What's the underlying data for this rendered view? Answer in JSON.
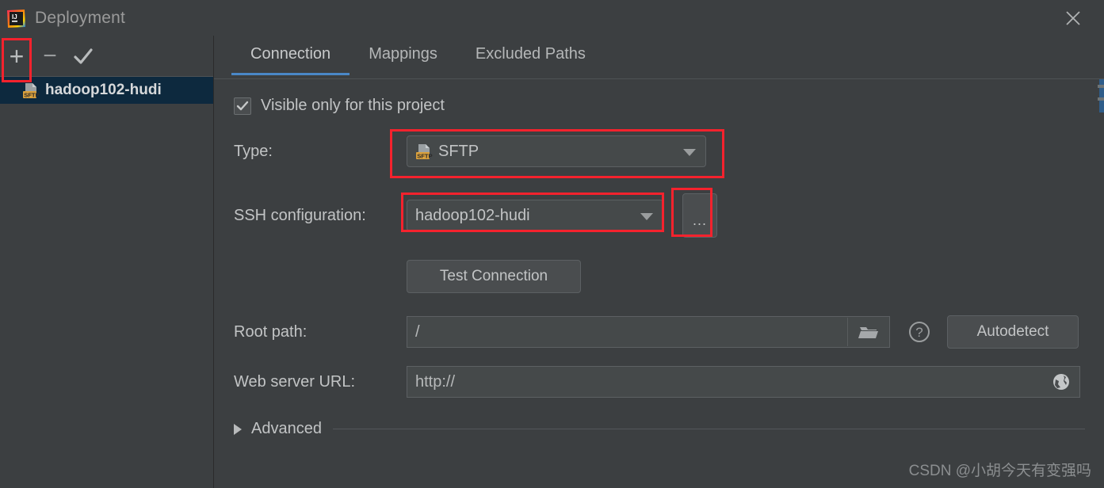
{
  "window": {
    "title": "Deployment",
    "logo_text": "IJ",
    "close_label": "×"
  },
  "left_panel": {
    "toolbar": [
      {
        "name": "add-button",
        "glyph": "+"
      },
      {
        "name": "remove-button",
        "glyph": "−"
      },
      {
        "name": "apply-button",
        "glyph": "✓"
      }
    ],
    "items": [
      {
        "label": "hadoop102-hudi",
        "type": "SFTP",
        "selected": true
      }
    ]
  },
  "tabs": [
    {
      "label": "Connection",
      "active": true
    },
    {
      "label": "Mappings",
      "active": false
    },
    {
      "label": "Excluded Paths",
      "active": false
    }
  ],
  "connection": {
    "visible_only_checkbox": {
      "label": "Visible only for this project",
      "checked": true
    },
    "type": {
      "label": "Type:",
      "value": "SFTP",
      "badge": "SFTP"
    },
    "ssh_configuration": {
      "label": "SSH configuration:",
      "value": "hadoop102-hudi",
      "browse_label": "..."
    },
    "test_connection_button": "Test Connection",
    "root_path": {
      "label": "Root path:",
      "value": "/",
      "help_glyph": "?",
      "autodetect_label": "Autodetect"
    },
    "web_server_url": {
      "label": "Web server URL:",
      "value": "http://"
    },
    "advanced": {
      "label": "Advanced",
      "expanded": false
    }
  },
  "watermark": "CSDN @小胡今天有变强吗",
  "colors": {
    "background": "#3c3f41",
    "field": "#45494a",
    "accent_tab": "#4a88c7",
    "selection": "#0d293e",
    "annotation": "#f5222d",
    "sftp_badge": "#d9a03c"
  }
}
